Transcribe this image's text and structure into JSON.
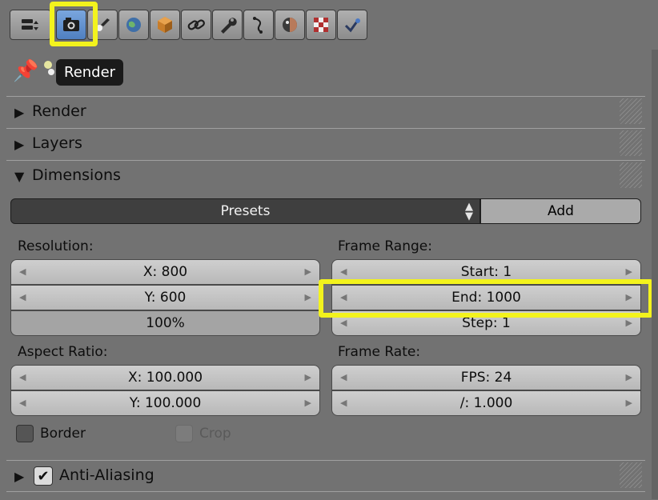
{
  "tooltip": "Render",
  "tabs": [
    {
      "icon": "render-layers-icon"
    },
    {
      "icon": "render-camera-icon"
    },
    {
      "icon": "scene-icon"
    },
    {
      "icon": "world-icon"
    },
    {
      "icon": "object-cube-icon"
    },
    {
      "icon": "constraints-link-icon"
    },
    {
      "icon": "modifiers-wrench-icon"
    },
    {
      "icon": "data-curve-icon"
    },
    {
      "icon": "material-sphere-icon"
    },
    {
      "icon": "texture-checker-icon"
    },
    {
      "icon": "particles-icon"
    }
  ],
  "panels": {
    "render": "Render",
    "layers": "Layers",
    "dimensions": "Dimensions",
    "antialiasing": "Anti-Aliasing"
  },
  "dimensions": {
    "presets_label": "Presets",
    "add_label": "Add",
    "resolution_label": "Resolution:",
    "res_x": "X: 800",
    "res_y": "Y: 600",
    "res_percent": "100%",
    "frame_range_label": "Frame Range:",
    "start": "Start: 1",
    "end": "End: 1000",
    "step": "Step: 1",
    "aspect_label": "Aspect Ratio:",
    "aspect_x": "X: 100.000",
    "aspect_y": "Y: 100.000",
    "frame_rate_label": "Frame Rate:",
    "fps": "FPS: 24",
    "fps_base": "/: 1.000",
    "border_label": "Border",
    "crop_label": "Crop"
  },
  "colors": {
    "highlight": "#f3f31d",
    "active_tab": "#5b8bcf",
    "panel_bg": "#727272"
  }
}
